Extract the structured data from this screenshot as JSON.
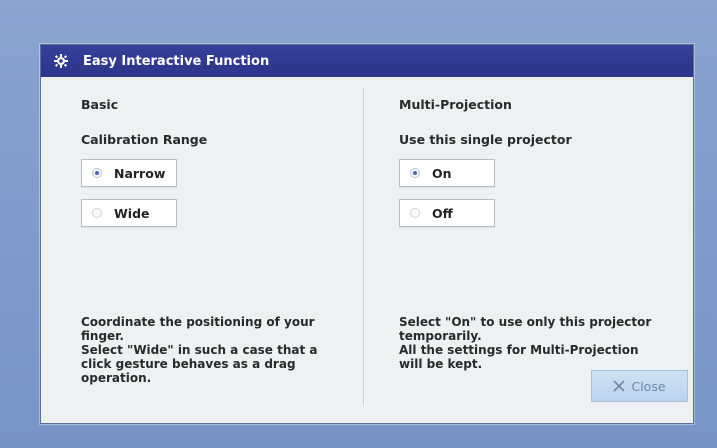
{
  "dialog": {
    "title": "Easy Interactive Function",
    "title_icon": "gear-icon"
  },
  "left": {
    "heading": "Basic",
    "subheading": "Calibration Range",
    "options": [
      {
        "label": "Narrow",
        "checked": true
      },
      {
        "label": "Wide",
        "checked": false
      }
    ],
    "description": "Coordinate the positioning of your\nfinger.\nSelect \"Wide\" in such a case that a\nclick gesture behaves as a drag\noperation."
  },
  "right": {
    "heading": "Multi-Projection",
    "subheading": "Use this single projector",
    "options": [
      {
        "label": "On",
        "checked": true
      },
      {
        "label": "Off",
        "checked": false
      }
    ],
    "description": "Select \"On\" to use only this projector\ntemporarily.\nAll the settings for Multi-Projection\nwill be kept."
  },
  "close_button": {
    "label": "Close",
    "icon": "close-icon"
  },
  "colors": {
    "background": "#8aa3cf",
    "titlebar": "#2c3588",
    "dialog": "#eef0f2",
    "radio_selected_dot": "#4a62b8",
    "close_button": "#c5daf0"
  }
}
